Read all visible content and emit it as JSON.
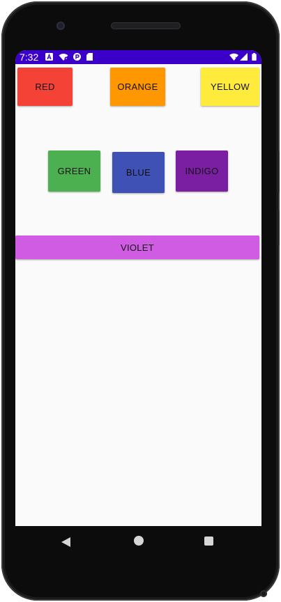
{
  "status_bar": {
    "time": "7:32",
    "left_icons": [
      "a-icon",
      "wifi-off-icon",
      "p-icon",
      "sd-card-icon"
    ],
    "right_icons": [
      "wifi-icon",
      "signal-icon",
      "battery-icon"
    ],
    "background_color": "#3a00c9"
  },
  "buttons": [
    {
      "name": "red-button",
      "label": "RED",
      "color": "#f44336"
    },
    {
      "name": "orange-button",
      "label": "ORANGE",
      "color": "#ff9800"
    },
    {
      "name": "yellow-button",
      "label": "YELLOW",
      "color": "#ffeb3b"
    },
    {
      "name": "green-button",
      "label": "GREEN",
      "color": "#4caf50"
    },
    {
      "name": "blue-button",
      "label": "BLUE",
      "color": "#3f51b5"
    },
    {
      "name": "indigo-button",
      "label": "INDIGO",
      "color": "#7b1fa2"
    },
    {
      "name": "violet-button",
      "label": "VIOLET",
      "color": "#d05ce3"
    }
  ],
  "nav_bar": {
    "icons": [
      "back-icon",
      "home-icon",
      "recents-icon"
    ]
  }
}
